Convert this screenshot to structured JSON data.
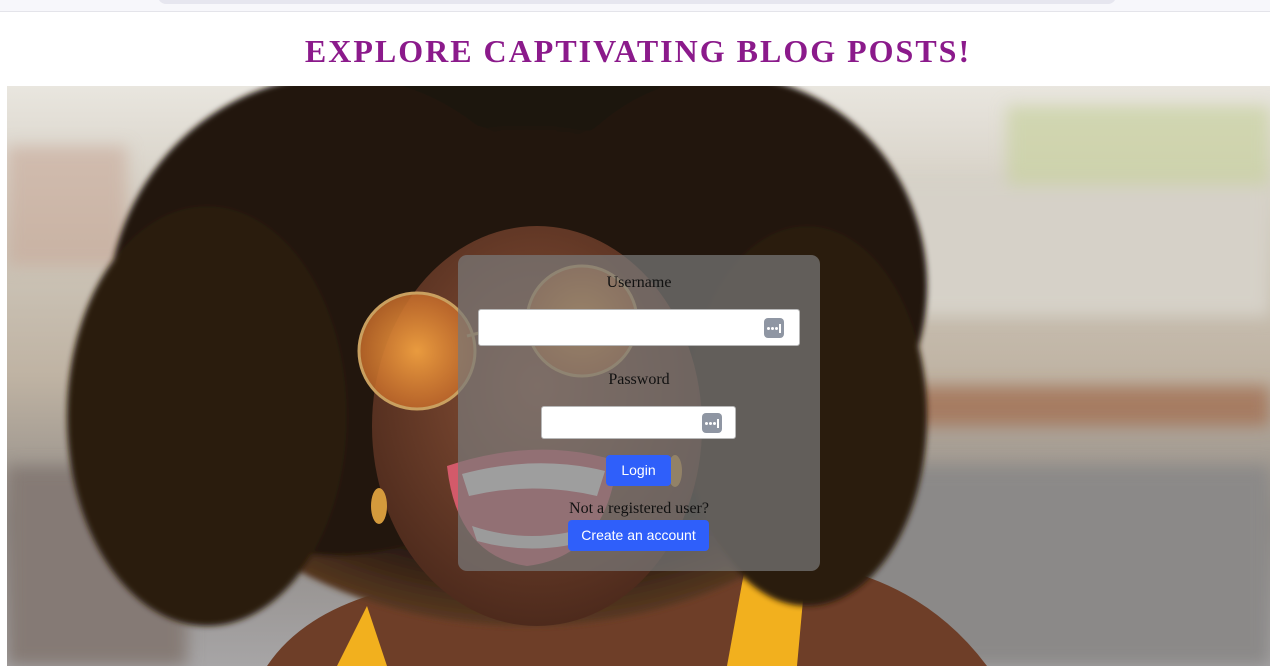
{
  "page": {
    "headline": "EXPLORE CAPTIVATING BLOG POSTS!"
  },
  "hero": {
    "description_icon": "photo-woman-laughing-with-sunglasses"
  },
  "login": {
    "username_label": "Username",
    "username_value": "",
    "password_label": "Password",
    "password_value": "",
    "login_button": "Login",
    "not_registered_text": "Not a registered user?",
    "create_account_button": "Create an account"
  },
  "colors": {
    "headline": "#8b1a8b",
    "button": "#2f5ffa",
    "card_overlay": "rgba(120,120,120,0.72)"
  }
}
